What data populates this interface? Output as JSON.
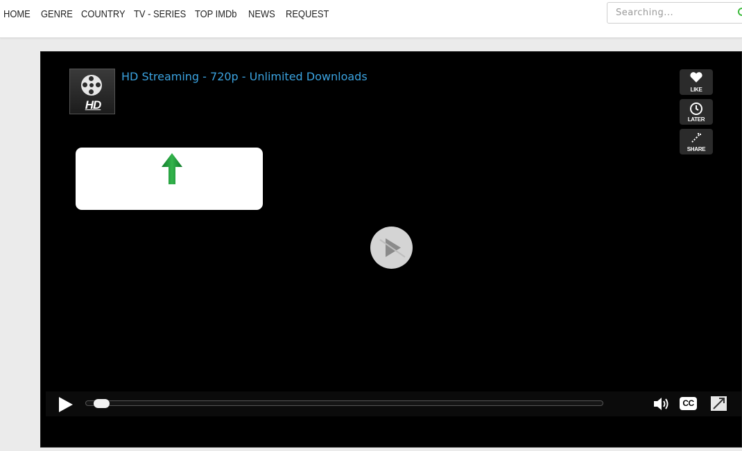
{
  "nav": {
    "items": [
      {
        "label": "HOME"
      },
      {
        "label": "GENRE"
      },
      {
        "label": "COUNTRY"
      },
      {
        "label": "TV - SERIES"
      },
      {
        "label": "TOP IMDb"
      },
      {
        "label": "NEWS"
      },
      {
        "label": "REQUEST"
      }
    ]
  },
  "search": {
    "placeholder": "Searching...",
    "icon": "search-icon"
  },
  "player": {
    "thumb_label": "HD",
    "title": "HD Streaming - 720p - Unlimited Downloads",
    "side_buttons": [
      {
        "label": "LIKE",
        "icon": "heart-icon"
      },
      {
        "label": "LATER",
        "icon": "clock-icon"
      },
      {
        "label": "SHARE",
        "icon": "share-icon"
      }
    ],
    "upload_icon": "green-up-arrow-icon",
    "center_icon": "play-icon",
    "controls": {
      "progress": 0.03,
      "cc_label": "CC",
      "icons": [
        "play-icon",
        "volume-icon",
        "cc-icon",
        "fullscreen-icon"
      ]
    }
  },
  "colors": {
    "title_link": "#3ba3e0",
    "search_accent": "#3cba3c",
    "player_bg": "#000000",
    "upload_arrow": "#1e9a3a"
  }
}
